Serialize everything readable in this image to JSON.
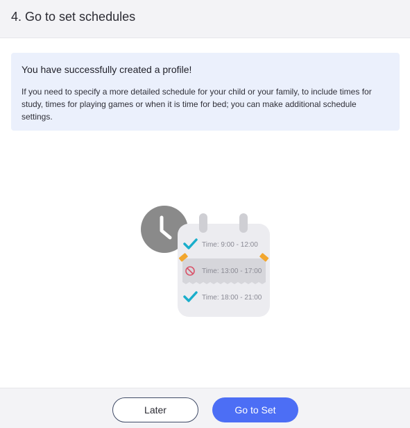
{
  "header": {
    "title": "4. Go to set schedules"
  },
  "info": {
    "title": "You have successfully created a profile!",
    "body": "If you need to specify a more detailed schedule for your child or your family, to include times for study, times for playing games or when it is time for bed; you can make additional schedule settings."
  },
  "illustration": {
    "slots": [
      {
        "label": "Time: 9:00 - 12:00",
        "status": "check-icon"
      },
      {
        "label": "Time: 13:00 - 17:00",
        "status": "blocked-icon"
      },
      {
        "label": "Time: 18:00 - 21:00",
        "status": "check-icon"
      }
    ],
    "colors": {
      "clock": "#8a8a8a",
      "calendar": "#ececf0",
      "check": "#1aaecb",
      "blocked": "#d9536a",
      "tape": "#f2a62e"
    }
  },
  "footer": {
    "later_label": "Later",
    "go_label": "Go to Set"
  },
  "colors": {
    "accent": "#4c6ef5",
    "info_bg": "#ebf0fc"
  }
}
